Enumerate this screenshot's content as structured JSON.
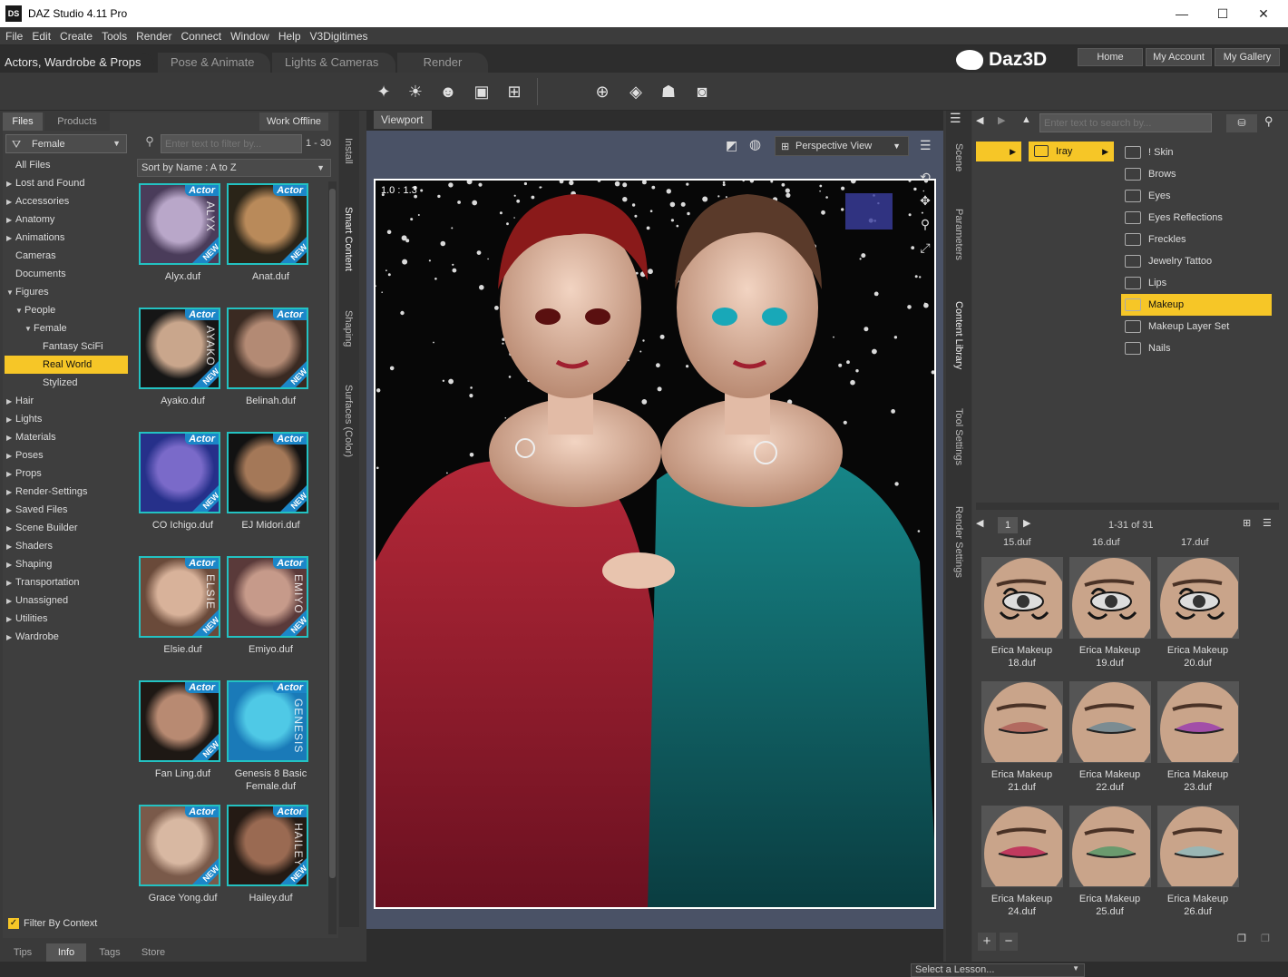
{
  "window": {
    "title": "DAZ Studio 4.11 Pro",
    "app_icon": "DS",
    "minimize": "—",
    "maximize": "☐",
    "close": "✕"
  },
  "menu": [
    "File",
    "Edit",
    "Create",
    "Tools",
    "Render",
    "Connect",
    "Window",
    "Help",
    "V3Digitimes"
  ],
  "layout_tabs": [
    "Actors, Wardrobe & Props",
    "Pose & Animate",
    "Lights & Cameras",
    "Render"
  ],
  "brand": {
    "logo": "Daz3D",
    "links": [
      "Home",
      "My Account",
      "My Gallery"
    ]
  },
  "left": {
    "tabs": [
      "Files",
      "Products"
    ],
    "work_offline": "Work Offline",
    "filter_category": "Female",
    "filter_placeholder": "Enter text to filter by...",
    "range": "1 - 30",
    "sort": "Sort by Name : A to Z",
    "categories": [
      {
        "label": "All Files",
        "tri": "",
        "indent": 0
      },
      {
        "label": "Lost and Found",
        "tri": "▶",
        "indent": 0
      },
      {
        "label": "Accessories",
        "tri": "▶",
        "indent": 0
      },
      {
        "label": "Anatomy",
        "tri": "▶",
        "indent": 0
      },
      {
        "label": "Animations",
        "tri": "▶",
        "indent": 0
      },
      {
        "label": "Cameras",
        "tri": "",
        "indent": 0
      },
      {
        "label": "Documents",
        "tri": "",
        "indent": 0
      },
      {
        "label": "Figures",
        "tri": "▼",
        "indent": 0
      },
      {
        "label": "People",
        "tri": "▼",
        "indent": 1
      },
      {
        "label": "Female",
        "tri": "▼",
        "indent": 2
      },
      {
        "label": "Fantasy SciFi",
        "tri": "",
        "indent": 3
      },
      {
        "label": "Real World",
        "tri": "",
        "indent": 3,
        "selected": true
      },
      {
        "label": "Stylized",
        "tri": "",
        "indent": 3
      },
      {
        "label": "Hair",
        "tri": "▶",
        "indent": 0
      },
      {
        "label": "Lights",
        "tri": "▶",
        "indent": 0
      },
      {
        "label": "Materials",
        "tri": "▶",
        "indent": 0
      },
      {
        "label": "Poses",
        "tri": "▶",
        "indent": 0
      },
      {
        "label": "Props",
        "tri": "▶",
        "indent": 0
      },
      {
        "label": "Render-Settings",
        "tri": "▶",
        "indent": 0
      },
      {
        "label": "Saved Files",
        "tri": "▶",
        "indent": 0
      },
      {
        "label": "Scene Builder",
        "tri": "▶",
        "indent": 0
      },
      {
        "label": "Shaders",
        "tri": "▶",
        "indent": 0
      },
      {
        "label": "Shaping",
        "tri": "▶",
        "indent": 0
      },
      {
        "label": "Transportation",
        "tri": "▶",
        "indent": 0
      },
      {
        "label": "Unassigned",
        "tri": "▶",
        "indent": 0
      },
      {
        "label": "Utilities",
        "tri": "▶",
        "indent": 0
      },
      {
        "label": "Wardrobe",
        "tri": "▶",
        "indent": 0
      }
    ],
    "filter_by_context": "Filter By Context",
    "items": [
      {
        "name": "Alyx.duf",
        "badge": "Actor",
        "new": "NEW",
        "side": "ALYX",
        "c1": "#b9a7c9",
        "c2": "#4a3c5a"
      },
      {
        "name": "Anat.duf",
        "badge": "Actor",
        "new": "NEW",
        "side": "",
        "c1": "#b98a5a",
        "c2": "#2a2418"
      },
      {
        "name": "Ayako.duf",
        "badge": "Actor",
        "new": "NEW",
        "side": "AYAKO",
        "c1": "#c9a68c",
        "c2": "#161616"
      },
      {
        "name": "Belinah.duf",
        "badge": "Actor",
        "new": "NEW",
        "side": "",
        "c1": "#b38a74",
        "c2": "#3a2a22"
      },
      {
        "name": "CO Ichigo.duf",
        "badge": "Actor",
        "new": "NEW",
        "side": "",
        "c1": "#7a6ac9",
        "c2": "#26308a"
      },
      {
        "name": "EJ Midori.duf",
        "badge": "Actor",
        "new": "NEW",
        "side": "",
        "c1": "#a47858",
        "c2": "#121212"
      },
      {
        "name": "Elsie.duf",
        "badge": "Actor",
        "new": "NEW",
        "side": "ELSIE",
        "c1": "#d8b29a",
        "c2": "#6a4a3a"
      },
      {
        "name": "Emiyo.duf",
        "badge": "Actor",
        "new": "NEW",
        "side": "EMIYO",
        "c1": "#c69a8a",
        "c2": "#5a3a3a"
      },
      {
        "name": "Fan Ling.duf",
        "badge": "Actor",
        "new": "NEW",
        "side": "",
        "c1": "#b88a72",
        "c2": "#1e1814"
      },
      {
        "name": "Genesis 8 Basic Female.duf",
        "badge": "Actor",
        "new": "",
        "side": "GENESIS",
        "c1": "#4fc9e6",
        "c2": "#1a7ab8"
      },
      {
        "name": "Grace Yong.duf",
        "badge": "Actor",
        "new": "NEW",
        "side": "",
        "c1": "#d8b8a2",
        "c2": "#7a5a4a"
      },
      {
        "name": "Hailey.duf",
        "badge": "Actor",
        "new": "NEW",
        "side": "HAILEY",
        "c1": "#9a6a52",
        "c2": "#241a14"
      }
    ],
    "bottom_tabs": [
      "Tips",
      "Info",
      "Tags",
      "Store"
    ],
    "side_tabs": [
      "Install",
      "Smart Content",
      "Shaping",
      "Surfaces (Color)"
    ]
  },
  "viewport": {
    "tab": "Viewport",
    "view": "Perspective View",
    "frame_label": "1.0 : 1.3"
  },
  "right": {
    "side_tabs": [
      "Scene",
      "Parameters",
      "Content Library",
      "Tool Settings",
      "Render Settings"
    ],
    "search_placeholder": "Enter text to search by...",
    "crumb": "Iray",
    "folders": [
      "! Skin",
      "Brows",
      "Eyes",
      "Eyes Reflections",
      "Freckles",
      "Jewelry Tattoo",
      "Lips",
      "Makeup",
      "Makeup Layer Set",
      "Nails"
    ],
    "selected_folder": "Makeup",
    "page": "1",
    "count": "1-31 of 31",
    "partial": [
      "15.duf",
      "16.duf",
      "17.duf"
    ],
    "items": [
      {
        "name": "Erica Makeup 18.duf",
        "color": "#151515",
        "kind": "tattoo"
      },
      {
        "name": "Erica Makeup 19.duf",
        "color": "#151515",
        "kind": "tattoo"
      },
      {
        "name": "Erica Makeup 20.duf",
        "color": "#151515",
        "kind": "tattoo"
      },
      {
        "name": "Erica Makeup 21.duf",
        "color": "#b26a60",
        "kind": "shadow"
      },
      {
        "name": "Erica Makeup 22.duf",
        "color": "#7c8c92",
        "kind": "shadow"
      },
      {
        "name": "Erica Makeup 23.duf",
        "color": "#a24ea8",
        "kind": "shadow"
      },
      {
        "name": "Erica Makeup 24.duf",
        "color": "#c03a5e",
        "kind": "shadow"
      },
      {
        "name": "Erica Makeup 25.duf",
        "color": "#6a9a6e",
        "kind": "shadow"
      },
      {
        "name": "Erica Makeup 26.duf",
        "color": "#9ab6b4",
        "kind": "shadow"
      }
    ],
    "add": "+",
    "remove": "−"
  },
  "status": {
    "lesson": "Select a Lesson..."
  },
  "colors": {
    "accent": "#f6c627",
    "thumb_border": "#23c2c2",
    "badge": "#1c86c8"
  }
}
